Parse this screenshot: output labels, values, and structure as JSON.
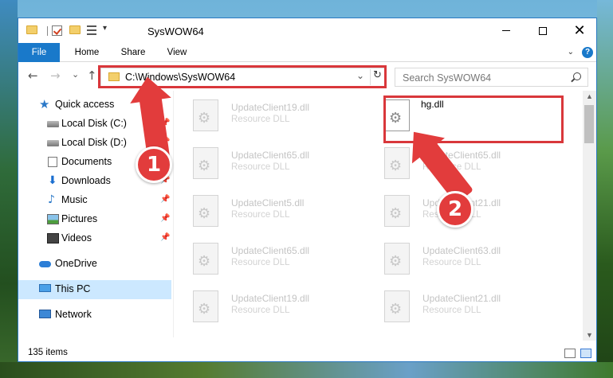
{
  "window": {
    "title": "SysWOW64",
    "controls": {
      "minimize": "—",
      "maximize": "☐",
      "close": "✕"
    }
  },
  "ribbon": {
    "tabs": [
      "File",
      "Home",
      "Share",
      "View"
    ],
    "help": "?"
  },
  "address": {
    "path": "C:\\Windows\\SysWOW64",
    "search_placeholder": "Search SysWOW64"
  },
  "nav": {
    "back": "←",
    "forward": "→",
    "recent": "⌄",
    "up": "↑",
    "refresh": "↻",
    "dropdown": "⌄"
  },
  "sidebar": {
    "items": [
      {
        "label": "Quick access",
        "icon": "star-icon"
      },
      {
        "label": "Local Disk (C:)",
        "icon": "drive-icon",
        "pinned": true
      },
      {
        "label": "Local Disk (D:)",
        "icon": "drive-icon",
        "pinned": true
      },
      {
        "label": "Documents",
        "icon": "documents-icon",
        "pinned": true
      },
      {
        "label": "Downloads",
        "icon": "downloads-icon",
        "pinned": true
      },
      {
        "label": "Music",
        "icon": "music-icon",
        "pinned": true
      },
      {
        "label": "Pictures",
        "icon": "pictures-icon",
        "pinned": true
      },
      {
        "label": "Videos",
        "icon": "videos-icon",
        "pinned": true
      },
      {
        "label": "OneDrive",
        "icon": "onedrive-icon"
      },
      {
        "label": "This PC",
        "icon": "pc-icon",
        "selected": true
      },
      {
        "label": "Network",
        "icon": "network-icon"
      }
    ]
  },
  "files": {
    "left_column": [
      {
        "name": "UpdateClient19.dll",
        "type": "Resource DLL"
      },
      {
        "name": "UpdateClient65.dll",
        "type": "Resource DLL"
      },
      {
        "name": "UpdateClient5.dll",
        "type": "Resource DLL"
      },
      {
        "name": "UpdateClient65.dll",
        "type": "Resource DLL"
      },
      {
        "name": "UpdateClient19.dll",
        "type": "Resource DLL"
      }
    ],
    "right_column": [
      {
        "name": "hg.dll",
        "type": ""
      },
      {
        "name": "UpdateClient65.dll",
        "type": "Resource DLL"
      },
      {
        "name": "UpdateClient21.dll",
        "type": "Resource DLL"
      },
      {
        "name": "UpdateClient63.dll",
        "type": "Resource DLL"
      },
      {
        "name": "UpdateClient21.dll",
        "type": "Resource DLL"
      }
    ]
  },
  "status": {
    "item_count": "135 items"
  },
  "callouts": {
    "step1": "1",
    "step2": "2"
  },
  "colors": {
    "accent": "#1979ca",
    "highlight": "#d9373b",
    "selected": "#cce8ff"
  }
}
